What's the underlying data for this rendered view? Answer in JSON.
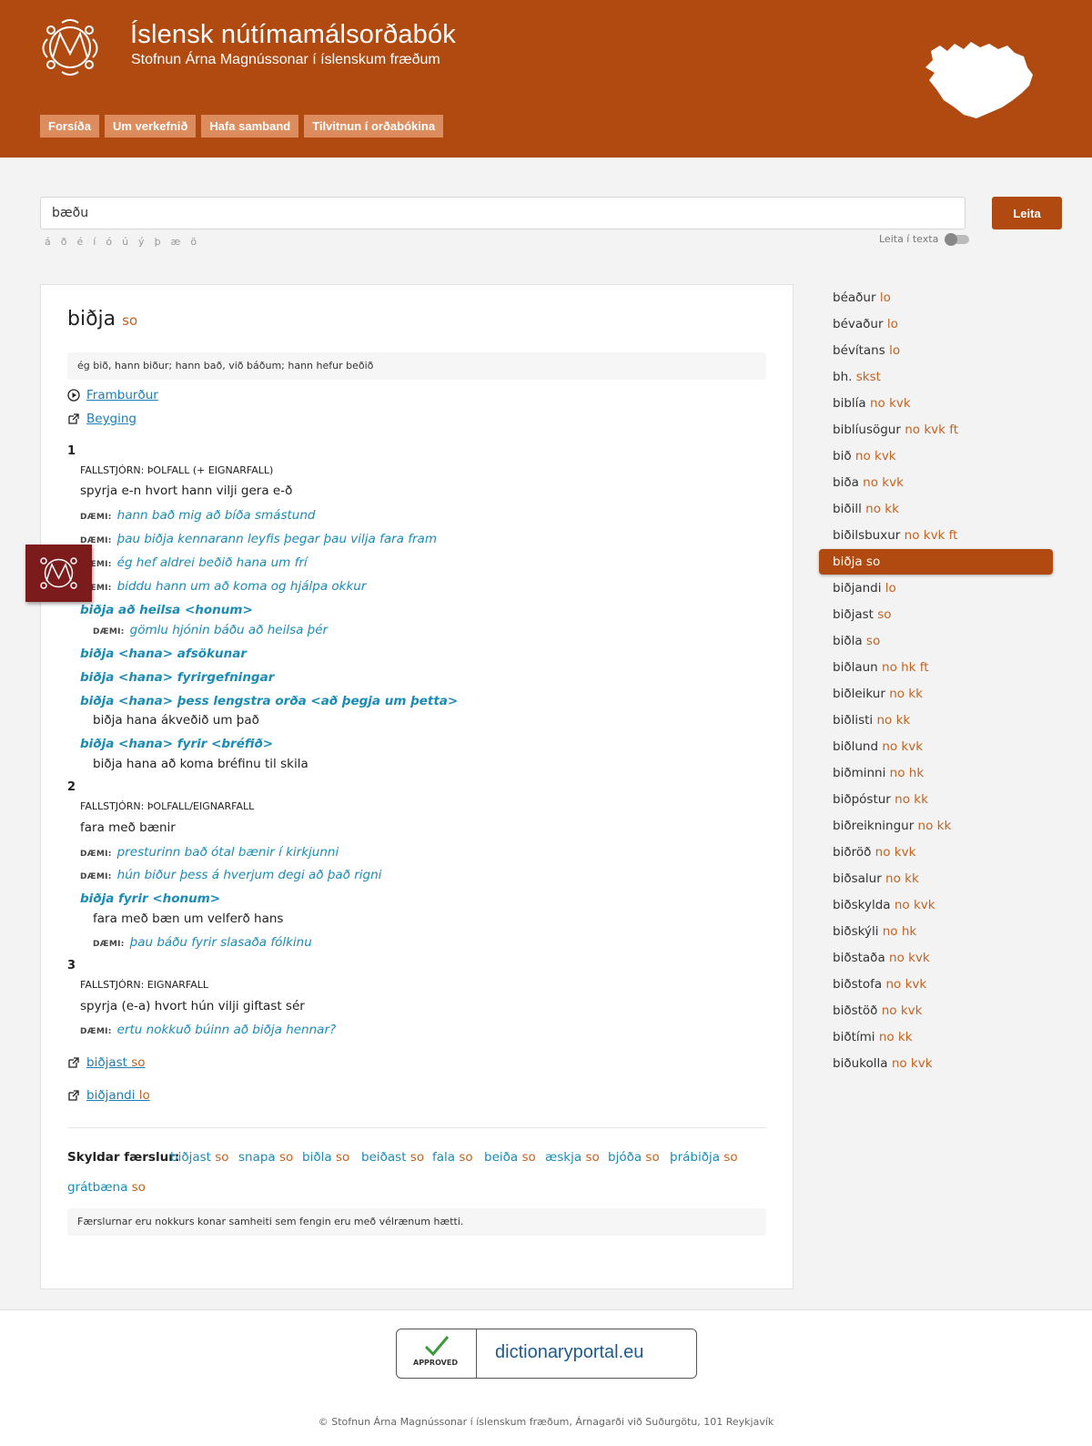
{
  "header": {
    "title": "Íslensk nútímamálsorðabók",
    "subtitle": "Stofnun Árna Magnússonar í íslenskum fræðum",
    "nav": [
      "Forsíða",
      "Um verkefnið",
      "Hafa samband",
      "Tilvitnun í orðabókina"
    ]
  },
  "search": {
    "value": "bæðu",
    "button": "Leita",
    "special_chars": [
      "á",
      "ð",
      "é",
      "í",
      "ó",
      "ú",
      "ý",
      "þ",
      "æ",
      "ö"
    ],
    "toggle_label": "Leita í texta"
  },
  "entry": {
    "headword": "biðja",
    "pos": "so",
    "inflection": "ég bið, hann biður; hann bað, við báðum; hann hefur beðið",
    "pronunciation": "Framburður",
    "declension": "Beyging",
    "example_label": "DÆMI:",
    "senses": [
      {
        "num": "1",
        "gov": "FALLSTJÓRN: ÞOLFALL (+ EIGNARFALL)",
        "def": "spyrja e-n hvort hann vilji gera e-ð",
        "examples": [
          "hann bað mig að bíða smástund",
          "þau biðja kennarann leyfis þegar þau vilja fara fram",
          "ég hef aldrei beðið hana um frí",
          "biddu hann um að koma og hjálpa okkur"
        ],
        "idioms": [
          {
            "phrase": "biðja að heilsa <honum>",
            "example": "gömlu hjónin báðu að heilsa þér"
          },
          {
            "phrase": "biðja <hana> afsökunar"
          },
          {
            "phrase": "biðja <hana> fyrirgefningar"
          },
          {
            "phrase": "biðja <hana> þess lengstra orða <að þegja um þetta>",
            "def": "biðja hana ákveðið um það"
          },
          {
            "phrase": "biðja <hana> fyrir <bréfið>",
            "def": "biðja hana að koma bréfinu til skila"
          }
        ]
      },
      {
        "num": "2",
        "gov": "FALLSTJÓRN: ÞOLFALL/EIGNARFALL",
        "def": "fara með bænir",
        "examples": [
          "presturinn bað ótal bænir í kirkjunni",
          "hún biður þess á hverjum degi að það rigni"
        ],
        "idioms": [
          {
            "phrase": "biðja fyrir <honum>",
            "def": "fara með bæn um velferð hans",
            "example": "þau báðu fyrir slasaða fólkinu"
          }
        ]
      },
      {
        "num": "3",
        "gov": "FALLSTJÓRN: EIGNARFALL",
        "def": "spyrja (e-a) hvort hún vilji giftast sér",
        "examples": [
          "ertu nokkuð búinn að biðja hennar?"
        ]
      }
    ],
    "sub_entries": [
      {
        "word": "biðjast",
        "pos": "so"
      },
      {
        "word": "biðjandi",
        "pos": "lo"
      }
    ],
    "related_label": "Skyldar færslur:",
    "related": [
      {
        "word": "biðjast",
        "pos": "so"
      },
      {
        "word": "snapa",
        "pos": "so"
      },
      {
        "word": "biðla",
        "pos": "so"
      },
      {
        "word": "beiðast",
        "pos": "so"
      },
      {
        "word": "fala",
        "pos": "so"
      },
      {
        "word": "beiða",
        "pos": "so"
      },
      {
        "word": "æskja",
        "pos": "so"
      },
      {
        "word": "bjóða",
        "pos": "so"
      },
      {
        "word": "þrábiðja",
        "pos": "so"
      },
      {
        "word": "grátbæna",
        "pos": "so"
      }
    ],
    "note": "Færslurnar eru nokkurs konar samheiti sem fengin eru með vélrænum hætti."
  },
  "sidebar": [
    {
      "word": "béaður",
      "pos": "lo"
    },
    {
      "word": "bévaður",
      "pos": "lo"
    },
    {
      "word": "bévítans",
      "pos": "lo"
    },
    {
      "word": "bh.",
      "pos": "skst"
    },
    {
      "word": "biblía",
      "pos": "no kvk"
    },
    {
      "word": "biblíusögur",
      "pos": "no kvk ft"
    },
    {
      "word": "bið",
      "pos": "no kvk"
    },
    {
      "word": "biða",
      "pos": "no kvk"
    },
    {
      "word": "biðill",
      "pos": "no kk"
    },
    {
      "word": "biðilsbuxur",
      "pos": "no kvk ft"
    },
    {
      "word": "biðja",
      "pos": "so",
      "active": true
    },
    {
      "word": "biðjandi",
      "pos": "lo"
    },
    {
      "word": "biðjast",
      "pos": "so"
    },
    {
      "word": "biðla",
      "pos": "so"
    },
    {
      "word": "biðlaun",
      "pos": "no hk ft"
    },
    {
      "word": "biðleikur",
      "pos": "no kk"
    },
    {
      "word": "biðlisti",
      "pos": "no kk"
    },
    {
      "word": "biðlund",
      "pos": "no kvk"
    },
    {
      "word": "biðminni",
      "pos": "no hk"
    },
    {
      "word": "biðpóstur",
      "pos": "no kk"
    },
    {
      "word": "biðreikningur",
      "pos": "no kk"
    },
    {
      "word": "biðröð",
      "pos": "no kvk"
    },
    {
      "word": "biðsalur",
      "pos": "no kk"
    },
    {
      "word": "biðskylda",
      "pos": "no kvk"
    },
    {
      "word": "biðskýli",
      "pos": "no hk"
    },
    {
      "word": "biðstaða",
      "pos": "no kvk"
    },
    {
      "word": "biðstofa",
      "pos": "no kvk"
    },
    {
      "word": "biðstöð",
      "pos": "no kvk"
    },
    {
      "word": "biðtími",
      "pos": "no kk"
    },
    {
      "word": "biðukolla",
      "pos": "no kvk"
    }
  ],
  "footer": {
    "badge_approved": "APPROVED",
    "badge_site": "dictionaryportal.eu",
    "copyright": "© Stofnun Árna Magnússonar í íslenskum fræðum, Árnagarði við Suðurgötu, 101 Reykjavík"
  }
}
